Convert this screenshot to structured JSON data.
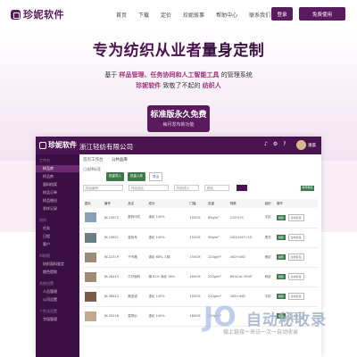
{
  "brand": {
    "name": "珍妮软件",
    "color": "#5a1a5e"
  },
  "nav": {
    "items": [
      "首页",
      "下载",
      "定价",
      "珍妮故事",
      "帮助中心",
      "联系我们"
    ],
    "login": "登录",
    "signup": "免费使用"
  },
  "hero": {
    "title_a": "专为纺织从业者",
    "title_b": "量身定制",
    "sub1_prefix": "基于",
    "sub1_highlight": "样品管理、任务协同和人工智能工具",
    "sub1_suffix": "的管理系统",
    "sub2_highlight1": "珍妮软件",
    "sub2_mid": "致敬了不起的",
    "sub2_highlight2": "纺织人",
    "cta_main": "标准版永久免费",
    "cta_sub": "每月发布新功能"
  },
  "app": {
    "logo": "珍妮软件",
    "company": "浙江轻纺有限公司",
    "user": "潘晨",
    "sidebar": [
      {
        "label": "工作台",
        "group": true
      },
      {
        "label": "样品库",
        "active": true
      },
      {
        "label": "样品库"
      },
      {
        "label": "面料档案"
      },
      {
        "label": "样品订单"
      },
      {
        "label": "样品借出"
      },
      {
        "label": "发样记录"
      },
      {
        "label": "协作",
        "group": true
      },
      {
        "label": "任务"
      },
      {
        "label": "日程"
      },
      {
        "label": "客户"
      },
      {
        "label": "AI助理",
        "group": true
      },
      {
        "label": "纺织面料鉴定"
      },
      {
        "label": "颜色提取"
      },
      {
        "label": "系统设置",
        "group": true
      },
      {
        "label": "人员管理"
      },
      {
        "label": "公司设置"
      },
      {
        "label": "个性化设置",
        "group": true
      },
      {
        "label": "字段管理"
      }
    ],
    "crumb": {
      "tab1": "首页工作台",
      "tab2": "公共品库"
    },
    "filter_label": "已选择标签",
    "tabs": [
      "批量导入",
      "批量入库",
      "导出"
    ],
    "selects": [
      "样品编号",
      "样品品名",
      "样品成分",
      "颜色"
    ],
    "export_label": "新增样品",
    "columns": [
      "图片",
      "编号",
      "品名",
      "成分",
      "门幅",
      "克重",
      "规格",
      "组织",
      "操作"
    ],
    "rows": [
      {
        "code": "JN-15672",
        "name": "数码印花",
        "comp": "涤纶 100%",
        "width": "150CM",
        "weight": "85g/m²",
        "spec": "21S*21S",
        "weave": "平纹",
        "thumb": "#8aa0b5"
      },
      {
        "code": "JN-19821",
        "name": "蓝色布",
        "comp": "涤纶 100%",
        "width": "152CM",
        "weight": "90g/m²",
        "spec": "20D/144F+15",
        "weave": "提花",
        "thumb": "#6d7d86"
      },
      {
        "code": "JN-22319",
        "name": "千鸟格",
        "comp": "涤纶 68% 人棉",
        "width": "150CM",
        "weight": "220g/m²",
        "spec": "40D+40D",
        "weave": "缎纹",
        "thumb": "#9a8b7a"
      },
      {
        "code": "JN-26415",
        "name": "牛仔面料",
        "comp": "棉 82% 涤纶 18%",
        "width": "160CM",
        "weight": "220g/m²",
        "spec": "60%Cot 35%P",
        "weave": "斜纹",
        "thumb": "#a08b73"
      },
      {
        "code": "JN-36612",
        "name": "麂皮绒",
        "comp": "涤纶 100%",
        "width": "150CM",
        "weight": "220g/m²",
        "spec": "40D+40D",
        "weave": "平纹",
        "thumb": "#7a5c4a"
      },
      {
        "code": "JN-35518",
        "name": "莫黛纱",
        "comp": "涤纶 100%",
        "width": "160CM",
        "weight": "220g/m²",
        "spec": "",
        "weave": "",
        "thumb": "#c2a88f"
      }
    ],
    "op_view": "编辑",
    "op_more": "生成标签"
  },
  "watermark": {
    "text": "自动秘收录",
    "sub": "做上链接一来访一次一自动收录"
  }
}
